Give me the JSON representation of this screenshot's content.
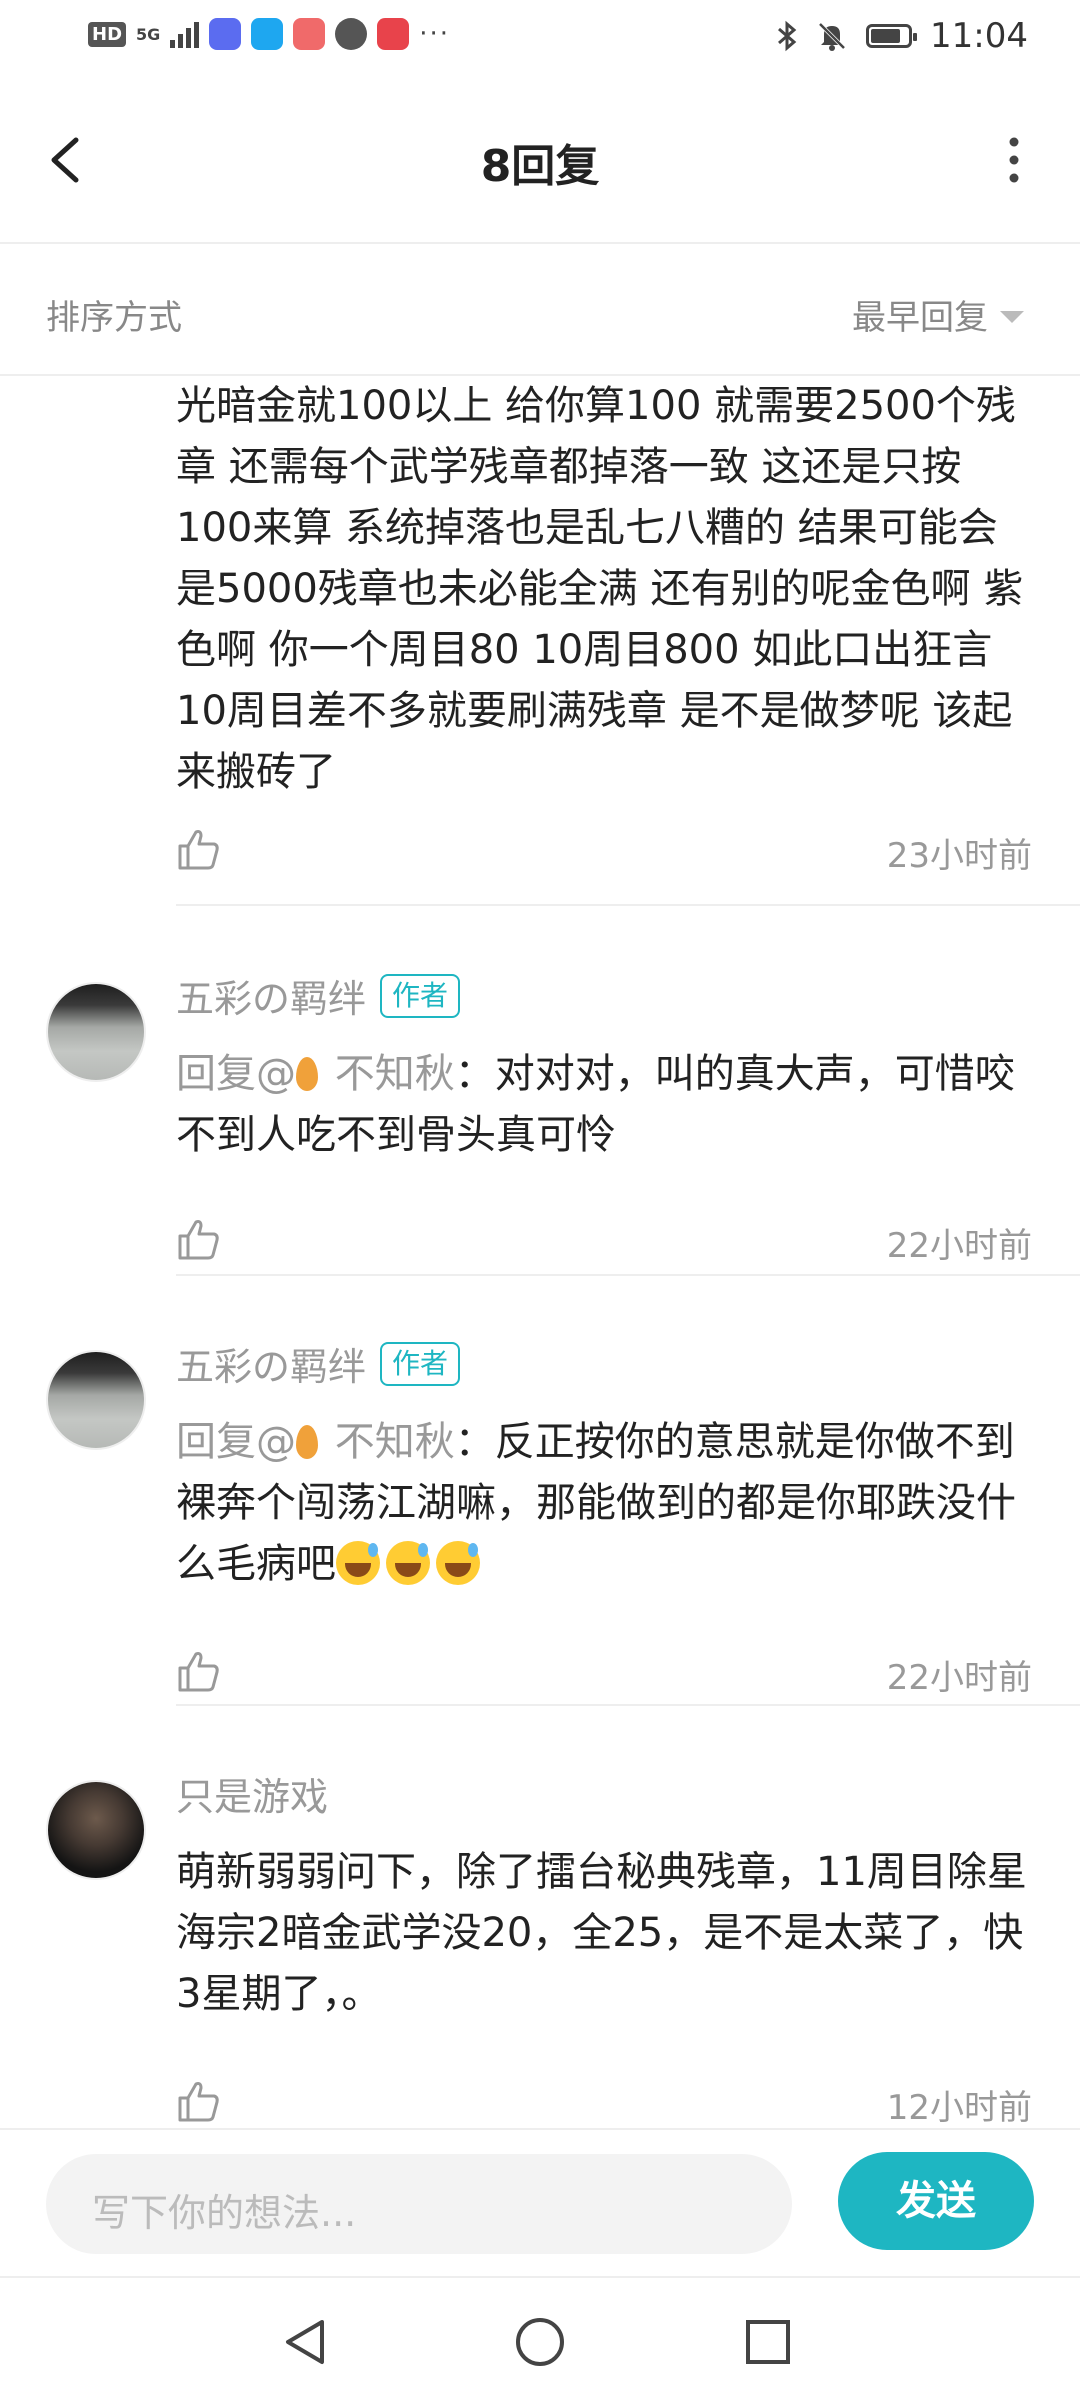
{
  "status_bar": {
    "network": "HD",
    "signal": "5G",
    "time": "11:04",
    "battery_level": 0.8,
    "icons": [
      "music-app-icon",
      "search-app-icon",
      "huawei-app-icon",
      "browser-app-icon",
      "reader-app-icon",
      "bluetooth-icon",
      "mute-bell-icon",
      "battery-icon"
    ]
  },
  "header": {
    "title": "8回复"
  },
  "sort": {
    "label": "排序方式",
    "value": "最早回复"
  },
  "comments": [
    {
      "text": "光暗金就100以上  给你算100 就需要2500个残章 还需每个武学残章都掉落一致 这还是只按100来算 系统掉落也是乱七八糟的 结果可能会是5000残章也未必能全满 还有别的呢金色啊 紫色啊 你一个周目80 10周目800 如此口出狂言10周目差不多就要刷满残章 是不是做梦呢 该起来搬砖了",
      "time": "23小时前"
    },
    {
      "username": "五彩の羁绊",
      "badge": "作者",
      "mention": "回复@",
      "mention_name": " 不知秋",
      "text": "：对对对，叫的真大声，可惜咬不到人吃不到骨头真可怜",
      "time": "22小时前"
    },
    {
      "username": "五彩の羁绊",
      "badge": "作者",
      "mention": "回复@",
      "mention_name": " 不知秋",
      "text": "：反正按你的意思就是你做不到裸奔个闯荡江湖嘛，那能做到的都是你耶跌没什么毛病吧",
      "emoji_count": 3,
      "time": "22小时前"
    },
    {
      "username": "只是游戏",
      "text": "萌新弱弱问下，除了擂台秘典残章，11周目除星海宗2暗金武学没20，全25，是不是太菜了，快3星期了，。",
      "time": "12小时前"
    }
  ],
  "input": {
    "placeholder": "写下你的想法...",
    "send_label": "发送"
  },
  "colors": {
    "accent": "#1eb6c2",
    "muted_text": "#999999"
  }
}
